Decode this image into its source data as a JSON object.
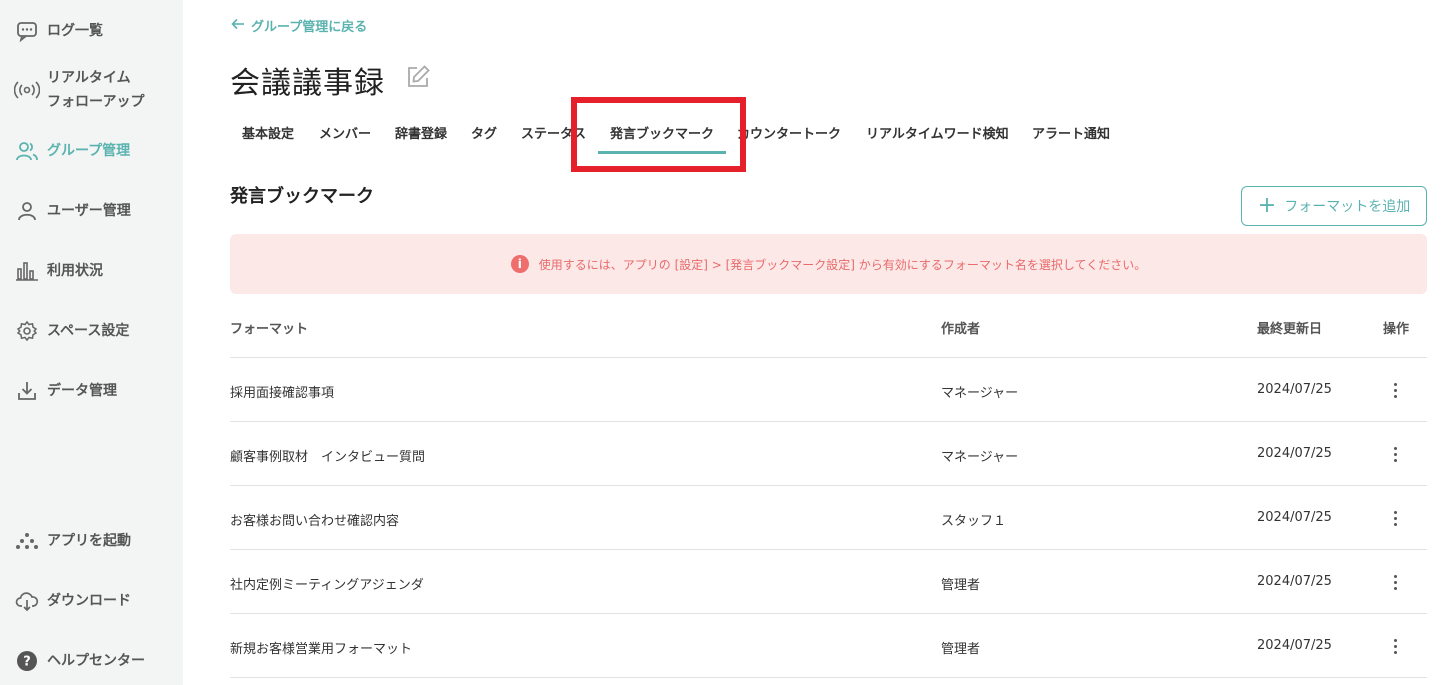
{
  "sidebar": {
    "items": [
      {
        "label": "ログ一覧",
        "icon": "chat-bubble-icon"
      },
      {
        "label": "リアルタイム\nフォローアップ",
        "icon": "broadcast-icon"
      },
      {
        "label": "グループ管理",
        "icon": "group-icon",
        "active": true
      },
      {
        "label": "ユーザー管理",
        "icon": "user-icon"
      },
      {
        "label": "利用状況",
        "icon": "bar-chart-icon"
      },
      {
        "label": "スペース設定",
        "icon": "gear-icon"
      },
      {
        "label": "データ管理",
        "icon": "download-tray-icon"
      }
    ],
    "bottom_items": [
      {
        "label": "アプリを起動",
        "icon": "app-launch-icon"
      },
      {
        "label": "ダウンロード",
        "icon": "cloud-download-icon"
      },
      {
        "label": "ヘルプセンター",
        "icon": "help-icon"
      }
    ]
  },
  "header": {
    "back_link": "グループ管理に戻る",
    "title": "会議議事録"
  },
  "tabs": [
    {
      "label": "基本設定"
    },
    {
      "label": "メンバー"
    },
    {
      "label": "辞書登録"
    },
    {
      "label": "タグ"
    },
    {
      "label": "ステータス"
    },
    {
      "label": "発言ブックマーク",
      "active": true
    },
    {
      "label": "カウンタートーク"
    },
    {
      "label": "リアルタイムワード検知"
    },
    {
      "label": "アラート通知"
    }
  ],
  "section": {
    "title": "発言ブックマーク",
    "add_button": "フォーマットを追加",
    "alert": "使用するには、アプリの [設定] > [発言ブックマーク設定] から有効にするフォーマット名を選択してください。"
  },
  "table": {
    "headers": {
      "format": "フォーマット",
      "author": "作成者",
      "updated": "最終更新日",
      "actions": "操作"
    },
    "rows": [
      {
        "format": "採用面接確認事項",
        "author": "マネージャー",
        "updated": "2024/07/25"
      },
      {
        "format": "顧客事例取材　インタビュー質問",
        "author": "マネージャー",
        "updated": "2024/07/25"
      },
      {
        "format": "お客様お問い合わせ確認内容",
        "author": "スタッフ１",
        "updated": "2024/07/25"
      },
      {
        "format": "社内定例ミーティングアジェンダ",
        "author": "管理者",
        "updated": "2024/07/25"
      },
      {
        "format": "新規お客様営業用フォーマット",
        "author": "管理者",
        "updated": "2024/07/25"
      }
    ]
  },
  "colors": {
    "accent": "#5bb3b0",
    "alert_bg": "#fde8e8",
    "alert_text": "#e86a6a",
    "highlight": "#e5202a"
  }
}
